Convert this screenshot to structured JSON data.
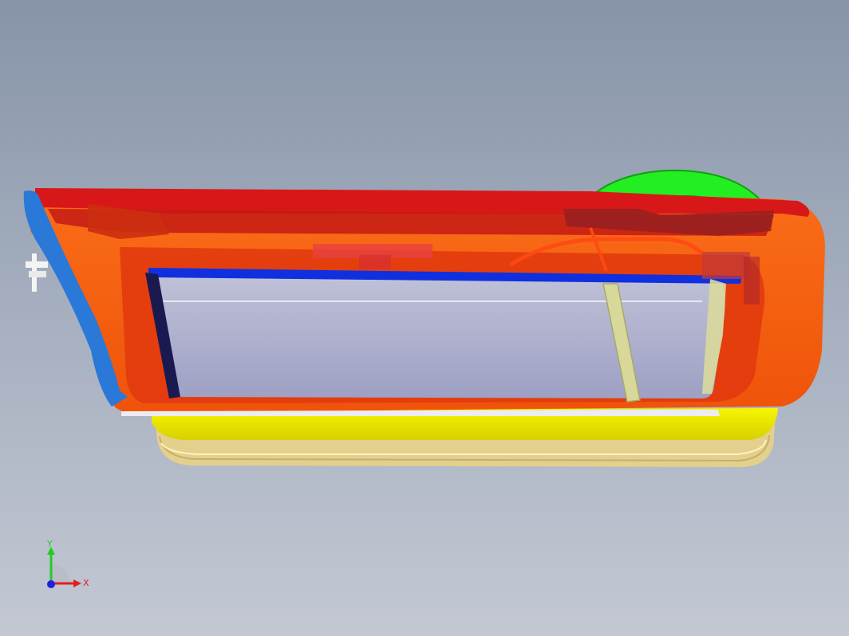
{
  "viewport": {
    "background_top": "#8794a8",
    "background_bottom": "#c3c8d3"
  },
  "model": {
    "colors": {
      "door_panel": "#ff5a00",
      "frame_top": "#d81818",
      "window_glass": "#a8aac8",
      "blue_strip": "#1030e0",
      "handle": "#22ee22",
      "seal": "#f2f200",
      "trim_strips": "#e8d99a",
      "left_edge": "#2a78d8",
      "divider": "#d8d89a"
    }
  },
  "triad": {
    "y_label": "Y",
    "x_label": "X",
    "y_color": "#22cc22",
    "x_color": "#e02020",
    "z_color": "#2020e0"
  }
}
